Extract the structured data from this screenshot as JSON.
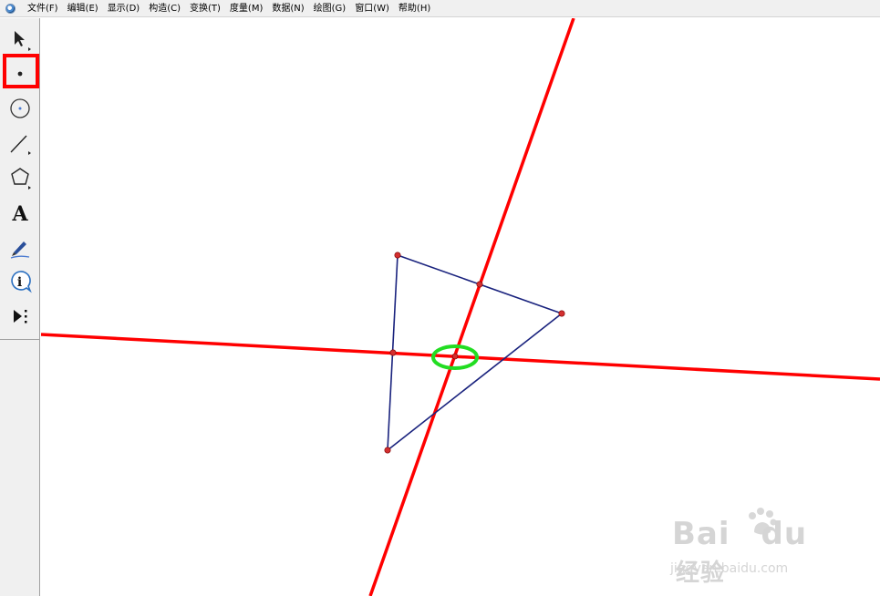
{
  "menu": {
    "items": [
      "文件(F)",
      "编辑(E)",
      "显示(D)",
      "构造(C)",
      "变换(T)",
      "度量(M)",
      "数据(N)",
      "绘图(G)",
      "窗口(W)",
      "帮助(H)"
    ]
  },
  "toolbox": {
    "tools": [
      {
        "name": "selection-arrow-tool-icon"
      },
      {
        "name": "point-tool-icon",
        "selected": true
      },
      {
        "name": "compass-tool-icon"
      },
      {
        "name": "straightedge-tool-icon"
      },
      {
        "name": "polygon-tool-icon"
      },
      {
        "name": "text-tool-icon",
        "glyph": "A"
      },
      {
        "name": "marker-tool-icon"
      },
      {
        "name": "information-tool-icon",
        "glyph": "i"
      },
      {
        "name": "custom-tools-icon"
      }
    ]
  },
  "colors": {
    "line": "#ff0000",
    "triangle": "#1a237e",
    "point": "#d32f2f",
    "highlight": "#22dd22",
    "tool_highlight": "#ff0000"
  },
  "watermark": {
    "brand_a": "Bai",
    "brand_b": "du",
    "brand_cn": "经验",
    "url": "jingyan.baidu.com"
  }
}
